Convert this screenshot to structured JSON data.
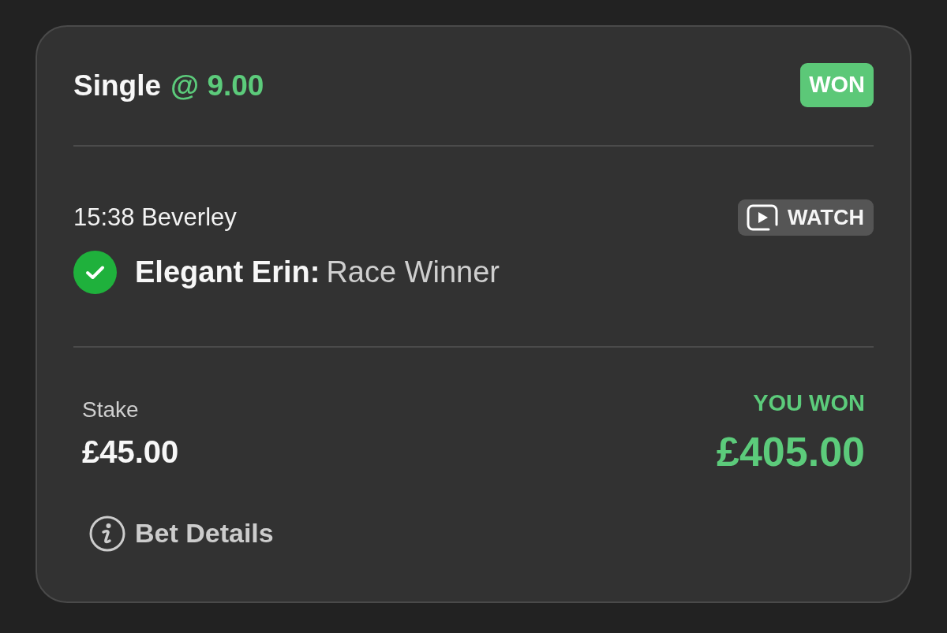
{
  "bet": {
    "type_label": "Single",
    "odds": "@ 9.00",
    "status": {
      "label": "WON",
      "kind": "won"
    }
  },
  "selection": {
    "event": "15:38 Beverley",
    "watch_button": "WATCH",
    "won": true,
    "name": "Elegant Erin:",
    "market": "Race Winner"
  },
  "stake": {
    "label": "Stake",
    "amount": "£45.00"
  },
  "returns": {
    "label": "YOU WON",
    "amount": "£405.00",
    "kind": "won"
  },
  "details_link": "Bet Details"
}
